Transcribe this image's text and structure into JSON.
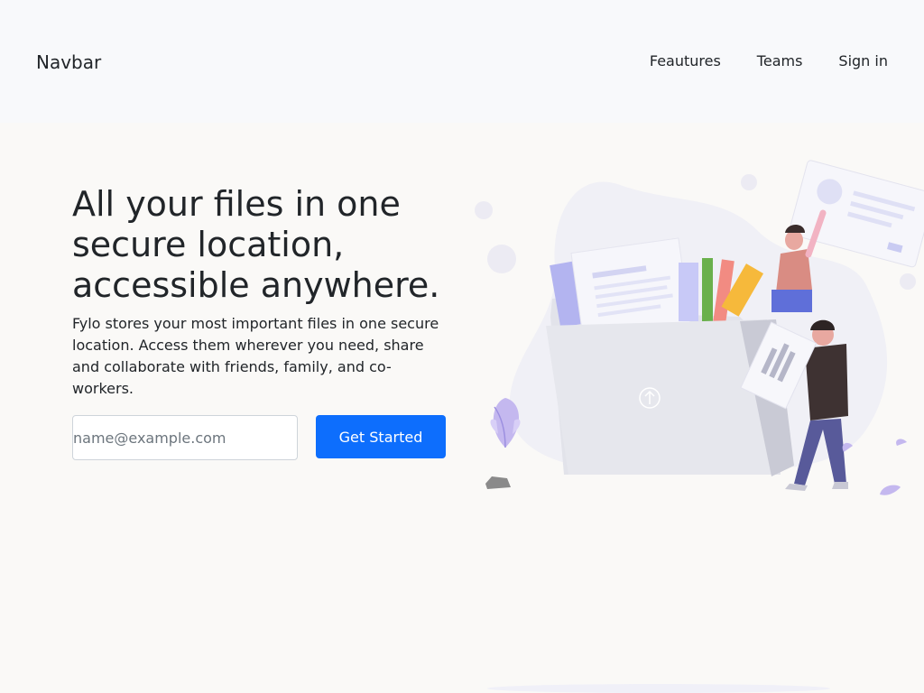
{
  "navbar": {
    "brand": "Navbar",
    "links": [
      {
        "label": "Feautures"
      },
      {
        "label": "Teams"
      },
      {
        "label": "Sign in"
      }
    ]
  },
  "hero": {
    "title": "All your files in one secure location, accessible anywhere.",
    "description": "Fylo stores your most important files in one secure location. Access them wherever you need, share and collaborate with friends, family, and co-workers.",
    "email_placeholder": "name@example.com",
    "cta_label": "Get Started",
    "illustration": "file-sharing-illustration"
  },
  "colors": {
    "primary": "#0d6efd",
    "navbar_bg": "#f8f9fb",
    "page_bg": "#faf9f7",
    "text": "#212529"
  }
}
